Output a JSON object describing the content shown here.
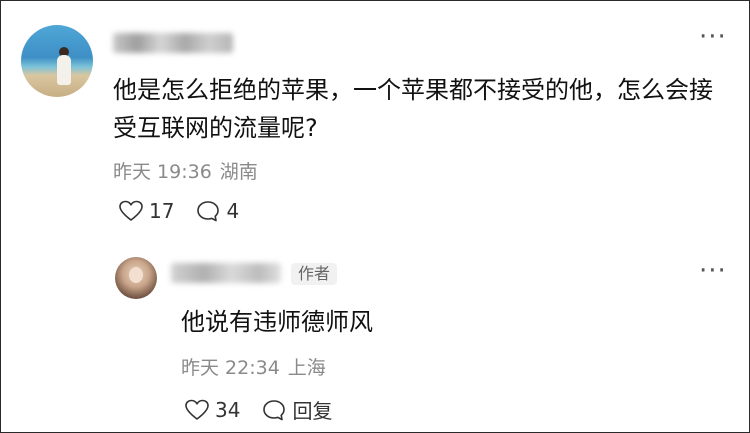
{
  "comment": {
    "author_name_hidden": true,
    "text": "他是怎么拒绝的苹果，一个苹果都不接受的他，怎么会接受互联网的流量呢?",
    "date": "昨天 19:36",
    "location": "湖南",
    "likes": "17",
    "replies": "4",
    "more_icon": "more-dots-icon"
  },
  "reply": {
    "author_name_hidden": true,
    "author_tag": "作者",
    "text": "他说有违师德师风",
    "date": "昨天 22:34",
    "location": "上海",
    "likes": "34",
    "reply_label": "回复",
    "more_icon": "more-dots-icon"
  },
  "icons": {
    "like": "heart-icon",
    "comment": "speech-bubble-icon"
  }
}
